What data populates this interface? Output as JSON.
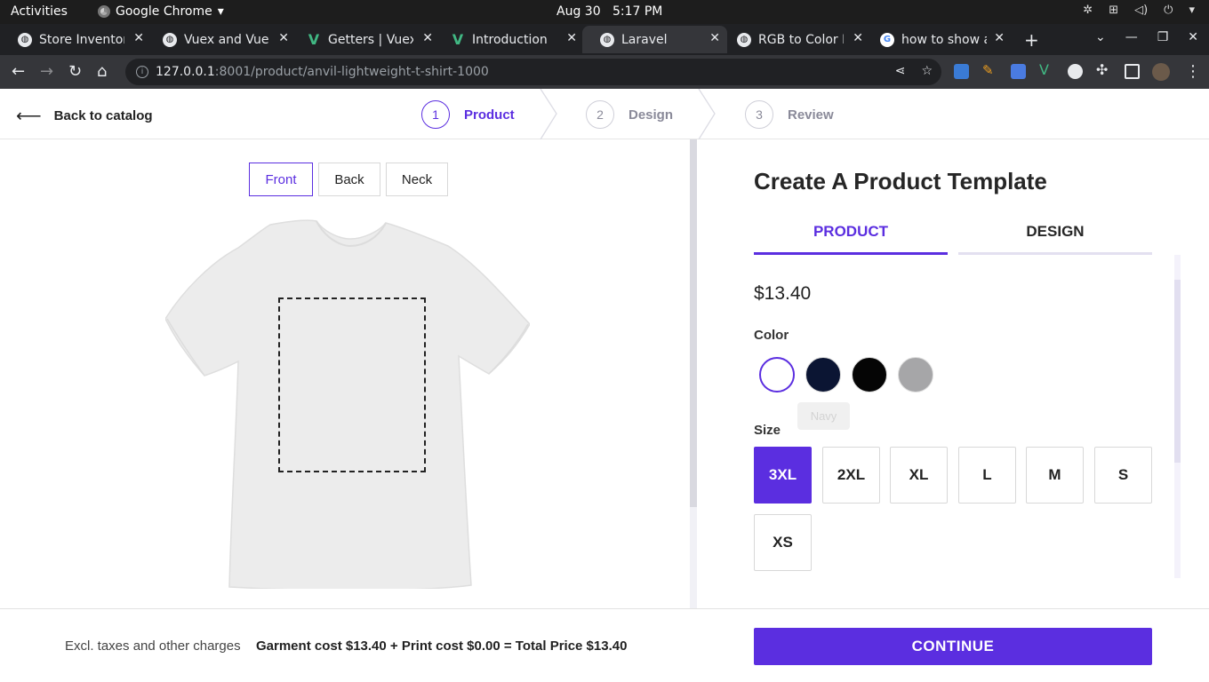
{
  "system": {
    "activities": "Activities",
    "app_name": "Google Chrome",
    "date": "Aug 30",
    "time": "5:17 PM"
  },
  "browser": {
    "tabs": [
      {
        "title": "Store Inventor",
        "favicon": "globe-icon",
        "active": false
      },
      {
        "title": "Vuex and Vue",
        "favicon": "globe-icon",
        "active": false
      },
      {
        "title": "Getters | Vuex",
        "favicon": "vue-icon",
        "active": false
      },
      {
        "title": "Introduction",
        "favicon": "vue-icon",
        "active": false
      },
      {
        "title": "Laravel",
        "favicon": "globe-icon",
        "active": true
      },
      {
        "title": "RGB to Color N",
        "favicon": "globe-icon",
        "active": false
      },
      {
        "title": "how to show a",
        "favicon": "google-icon",
        "active": false
      }
    ],
    "url_host": "127.0.0.1",
    "url_rest": ":8001/product/anvil-lightweight-t-shirt-1000"
  },
  "header": {
    "back_label": "Back to catalog",
    "steps": [
      {
        "num": "1",
        "label": "Product",
        "active": true
      },
      {
        "num": "2",
        "label": "Design",
        "active": false
      },
      {
        "num": "3",
        "label": "Review",
        "active": false
      }
    ]
  },
  "preview": {
    "views": [
      "Front",
      "Back",
      "Neck"
    ],
    "selected_view": "Front"
  },
  "panel": {
    "title": "Create A Product Template",
    "tabs": [
      "PRODUCT",
      "DESIGN"
    ],
    "active_tab": "PRODUCT",
    "price": "$13.40",
    "color_label": "Color",
    "colors": [
      {
        "name": "white",
        "hex": "#ffffff",
        "selected": true
      },
      {
        "name": "navy",
        "hex": "#0b1533",
        "selected": false
      },
      {
        "name": "black",
        "hex": "#050505",
        "selected": false
      },
      {
        "name": "grey",
        "hex": "#a6a6a8",
        "selected": false
      }
    ],
    "tooltip": "Navy",
    "size_label": "Size",
    "sizes": [
      "3XL",
      "2XL",
      "XL",
      "L",
      "M",
      "S",
      "XS"
    ],
    "selected_size": "3XL"
  },
  "footer": {
    "note": "Excl. taxes and other charges",
    "summary": "Garment cost $13.40 + Print cost $0.00 = Total Price $13.40",
    "continue_label": "CONTINUE"
  },
  "colors": {
    "accent": "#5b2ee0"
  }
}
